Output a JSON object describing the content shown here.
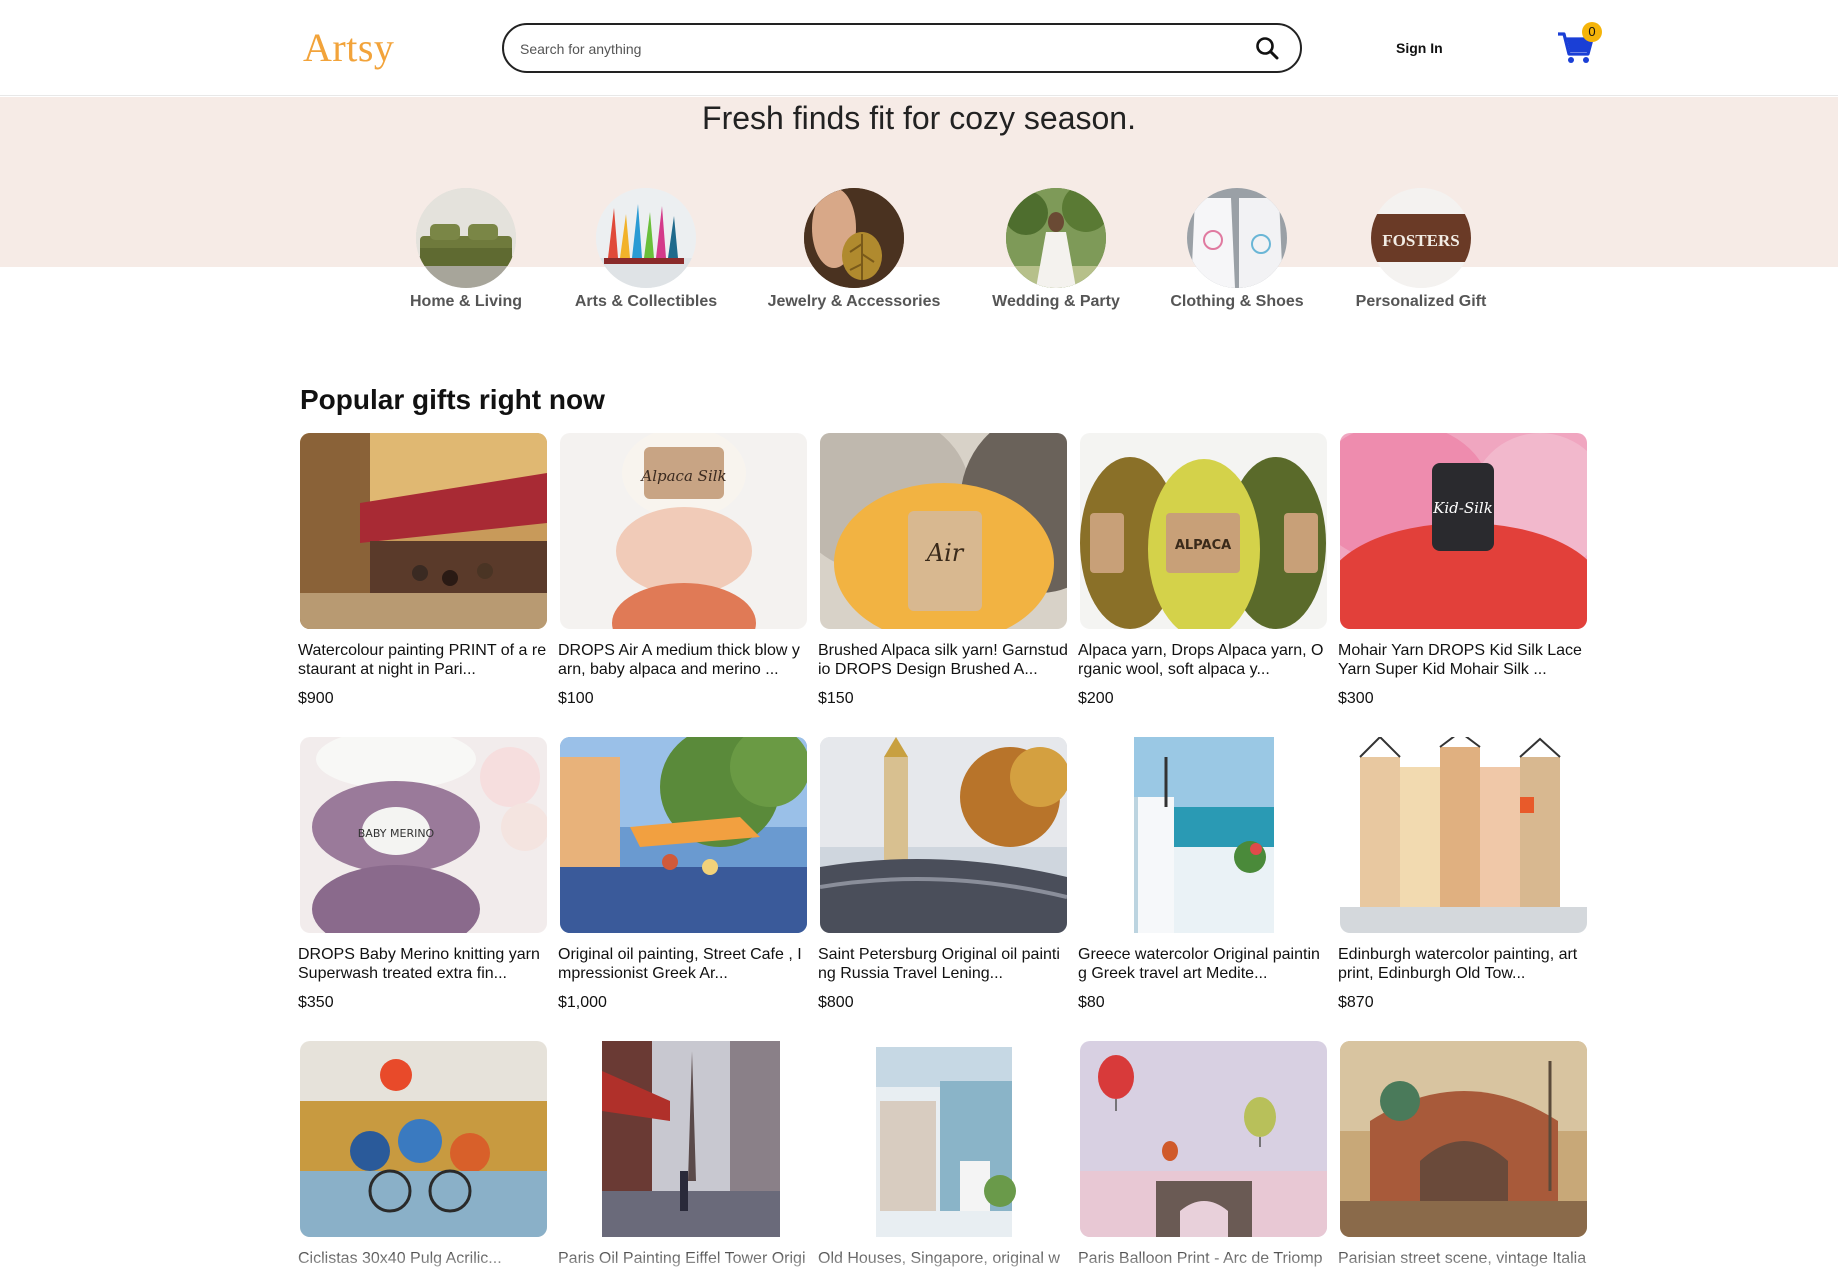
{
  "header": {
    "logo": "Artsy",
    "search_placeholder": "Search for anything",
    "signin_label": "Sign In",
    "cart_count": "0",
    "accent_color": "#f2a33a",
    "cart_color": "#1a3fd6",
    "icons": {
      "search": "search-icon",
      "cart": "cart-icon"
    }
  },
  "hero": {
    "title": "Fresh finds fit for cozy season.",
    "background_color": "#f6ebe6"
  },
  "categories": [
    {
      "label": "Home & Living"
    },
    {
      "label": "Arts & Collectibles"
    },
    {
      "label": "Jewelry & Accessories"
    },
    {
      "label": "Wedding & Party"
    },
    {
      "label": "Clothing & Shoes"
    },
    {
      "label": "Personalized Gift"
    }
  ],
  "categories_image_text": {
    "personalized": "FOSTERS"
  },
  "popular": {
    "title": "Popular gifts right now",
    "products": [
      {
        "title": "Watercolour painting PRINT of a restaurant at night in Pari...",
        "price": "$900"
      },
      {
        "title": "DROPS Air A medium thick blow yarn, baby alpaca and merino ...",
        "price": "$100"
      },
      {
        "title": "Brushed Alpaca silk yarn! Garnstudio DROPS Design Brushed A...",
        "price": "$150"
      },
      {
        "title": "Alpaca yarn, Drops Alpaca yarn, Organic wool, soft alpaca y...",
        "price": "$200"
      },
      {
        "title": "Mohair Yarn DROPS Kid Silk Lace Yarn Super Kid Mohair Silk ...",
        "price": "$300"
      },
      {
        "title": "DROPS Baby Merino knitting yarn Superwash treated extra fin...",
        "price": "$350"
      },
      {
        "title": "Original oil painting, Street Cafe , Impressionist Greek Ar...",
        "price": "$1,000"
      },
      {
        "title": "Saint Petersburg Original oil painting Russia Travel Lening...",
        "price": "$800"
      },
      {
        "title": "Greece watercolor Original painting Greek travel art Medite...",
        "price": "$80"
      },
      {
        "title": "Edinburgh watercolor painting, art print, Edinburgh Old Tow...",
        "price": "$870"
      },
      {
        "title": "Ciclistas 30x40 Pulg Acrilic...",
        "price": ""
      },
      {
        "title": "Paris Oil Painting Eiffel Tower Origi",
        "price": ""
      },
      {
        "title": "Old Houses, Singapore, original wa",
        "price": ""
      },
      {
        "title": "Paris Balloon Print - Arc de Triomp",
        "price": ""
      },
      {
        "title": "Parisian street scene, vintage Italia",
        "price": ""
      }
    ]
  },
  "product_image_labels": {
    "p2": "Alpaca Silk",
    "p3": "Air",
    "p4": "ALPACA",
    "p5": "Kid-Silk",
    "p6": "BABY MERINO"
  }
}
